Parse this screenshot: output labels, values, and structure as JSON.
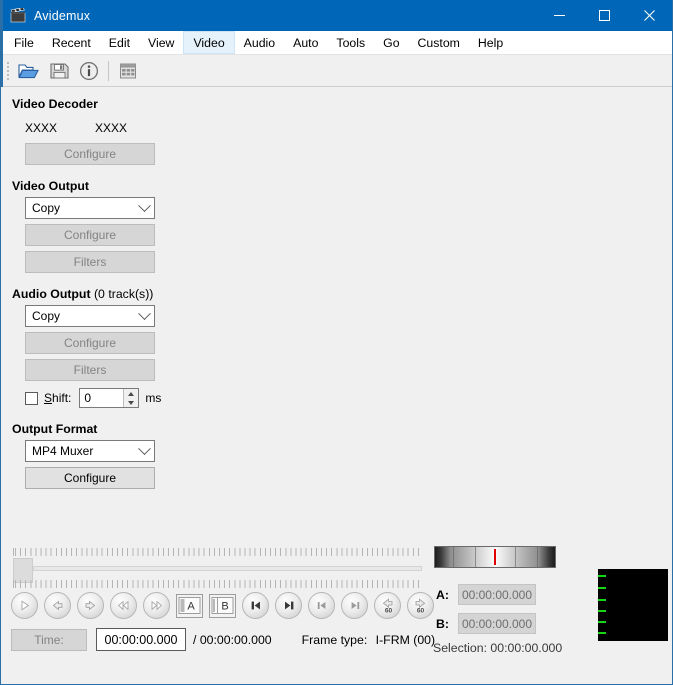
{
  "window": {
    "title": "Avidemux",
    "app_icon": "film-clapper-icon",
    "minimize_label": "–",
    "maximize_label": "☐",
    "close_label": "✕",
    "accent_color": "#0067b8",
    "border_color": "#2a6fa8"
  },
  "menubar": {
    "items": [
      {
        "label": "File",
        "active": false
      },
      {
        "label": "Recent",
        "active": false
      },
      {
        "label": "Edit",
        "active": false
      },
      {
        "label": "View",
        "active": false
      },
      {
        "label": "Video",
        "active": true
      },
      {
        "label": "Audio",
        "active": false
      },
      {
        "label": "Auto",
        "active": false
      },
      {
        "label": "Tools",
        "active": false
      },
      {
        "label": "Go",
        "active": false
      },
      {
        "label": "Custom",
        "active": false
      },
      {
        "label": "Help",
        "active": false
      }
    ]
  },
  "toolbar": {
    "buttons": [
      {
        "name": "open-file-icon",
        "tooltip": "Open"
      },
      {
        "name": "save-file-icon",
        "tooltip": "Save"
      },
      {
        "name": "info-icon",
        "tooltip": "Properties"
      },
      {
        "name": "calculator-film-icon",
        "tooltip": "Calculator"
      }
    ]
  },
  "video_decoder": {
    "title": "Video Decoder",
    "field_one": "XXXX",
    "field_two": "XXXX",
    "configure_label": "Configure",
    "configure_enabled": false
  },
  "video_output": {
    "title": "Video Output",
    "codec_value": "Copy",
    "configure_label": "Configure",
    "configure_enabled": false,
    "filters_label": "Filters",
    "filters_enabled": false
  },
  "audio_output": {
    "title": "Audio Output",
    "title_suffix": " (0 track(s))",
    "codec_value": "Copy",
    "configure_label": "Configure",
    "configure_enabled": false,
    "filters_label": "Filters",
    "filters_enabled": false,
    "shift_label": "Shift:",
    "shift_checked": false,
    "shift_value": "0",
    "shift_units": "ms"
  },
  "output_format": {
    "title": "Output Format",
    "muxer_value": "MP4 Muxer",
    "configure_label": "Configure",
    "configure_enabled": true
  },
  "transport": {
    "buttons": [
      {
        "name": "play-button",
        "glyph": "play"
      },
      {
        "name": "previous-frame-button",
        "glyph": "arrow-left"
      },
      {
        "name": "next-frame-button",
        "glyph": "arrow-right"
      },
      {
        "name": "rewind-button",
        "glyph": "double-left"
      },
      {
        "name": "forward-button",
        "glyph": "double-right"
      },
      {
        "name": "mark-a-button",
        "glyph": "marker-a",
        "label": "A"
      },
      {
        "name": "mark-b-button",
        "glyph": "marker-b",
        "label": "B"
      },
      {
        "name": "go-to-marker-a-button",
        "glyph": "skip-left"
      },
      {
        "name": "go-to-marker-b-button",
        "glyph": "skip-right"
      },
      {
        "name": "previous-keyframe-button",
        "glyph": "skip-start"
      },
      {
        "name": "next-keyframe-button",
        "glyph": "skip-end"
      },
      {
        "name": "back-60s-button",
        "glyph": "arrow-left-60",
        "badge": "60"
      },
      {
        "name": "forward-60s-button",
        "glyph": "arrow-right-60",
        "badge": "60"
      }
    ]
  },
  "timebar": {
    "time_button_label": "Time:",
    "time_button_enabled": false,
    "current_time": "00:00:00.000",
    "total_time": "/ 00:00:00.000",
    "frame_type_label": "Frame type:",
    "frame_type_value": "I-FRM (00)"
  },
  "selection_panel": {
    "marker_a_label": "A:",
    "marker_a_value": "00:00:00.000",
    "marker_b_label": "B:",
    "marker_b_value": "00:00:00.000",
    "selection_text": "Selection: 00:00:00.000",
    "navstrip_marker_color": "#e00000",
    "vumeter_tick_color": "#16d716"
  }
}
